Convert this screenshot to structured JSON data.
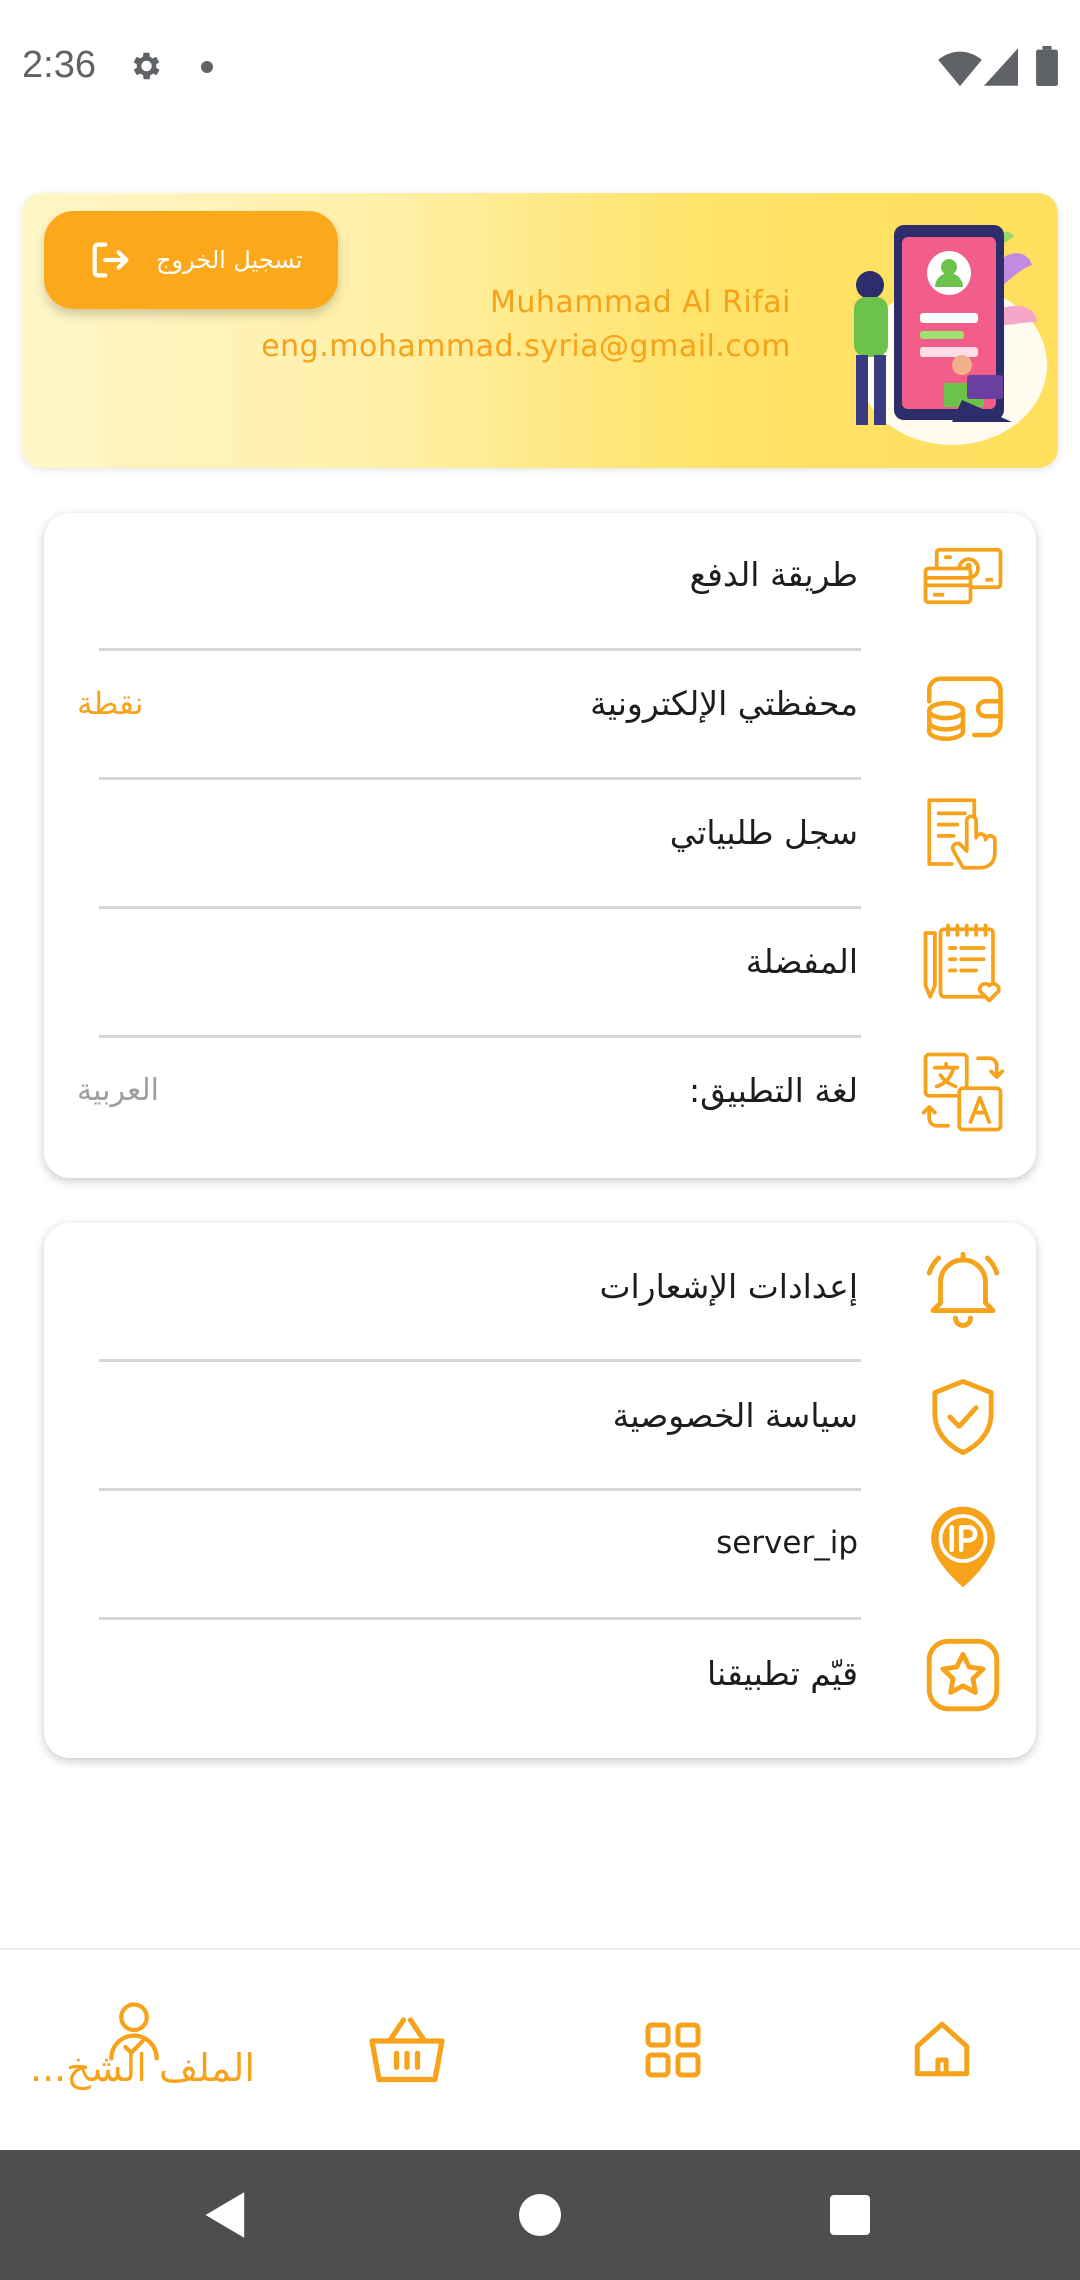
{
  "status_bar": {
    "time": "2:36",
    "icons": [
      "settings-icon",
      "dot-icon",
      "wifi-icon",
      "signal-icon",
      "battery-icon"
    ]
  },
  "header": {
    "logout_label": "تسجيل الخروج",
    "user_name": "Muhammad Al Rifai",
    "user_email": "eng.mohammad.syria@gmail.com",
    "illustration": "profile-illustration"
  },
  "menu_primary": [
    {
      "label": "طريقة الدفع",
      "icon": "payment-card-icon"
    },
    {
      "label": "محفظتي الإلكترونية",
      "icon": "wallet-coins-icon",
      "value": "نقطة"
    },
    {
      "label": "سجل طلبياتي",
      "icon": "orders-touch-icon"
    },
    {
      "label": "المفضلة",
      "icon": "favorites-list-icon"
    },
    {
      "label": "لغة التطبيق:",
      "icon": "translate-icon",
      "value": "العربية"
    }
  ],
  "menu_secondary": [
    {
      "label": "إعدادات الإشعارات",
      "icon": "bell-icon"
    },
    {
      "label": "سياسة الخصوصية",
      "icon": "shield-check-icon"
    },
    {
      "label": "server_ip",
      "icon": "ip-pin-icon"
    },
    {
      "label": "قيّم تطبيقنا",
      "icon": "star-rating-icon"
    }
  ],
  "bottom_nav": {
    "profile_label": "الملف الشخ...",
    "items": [
      "profile-icon",
      "basket-icon",
      "categories-icon",
      "home-icon"
    ]
  },
  "colors": {
    "accent": "#F6A21A",
    "header_gradient_start": "#FFF6C8",
    "header_gradient_end": "#FFDF5C",
    "system_nav": "#4E4E4E"
  }
}
